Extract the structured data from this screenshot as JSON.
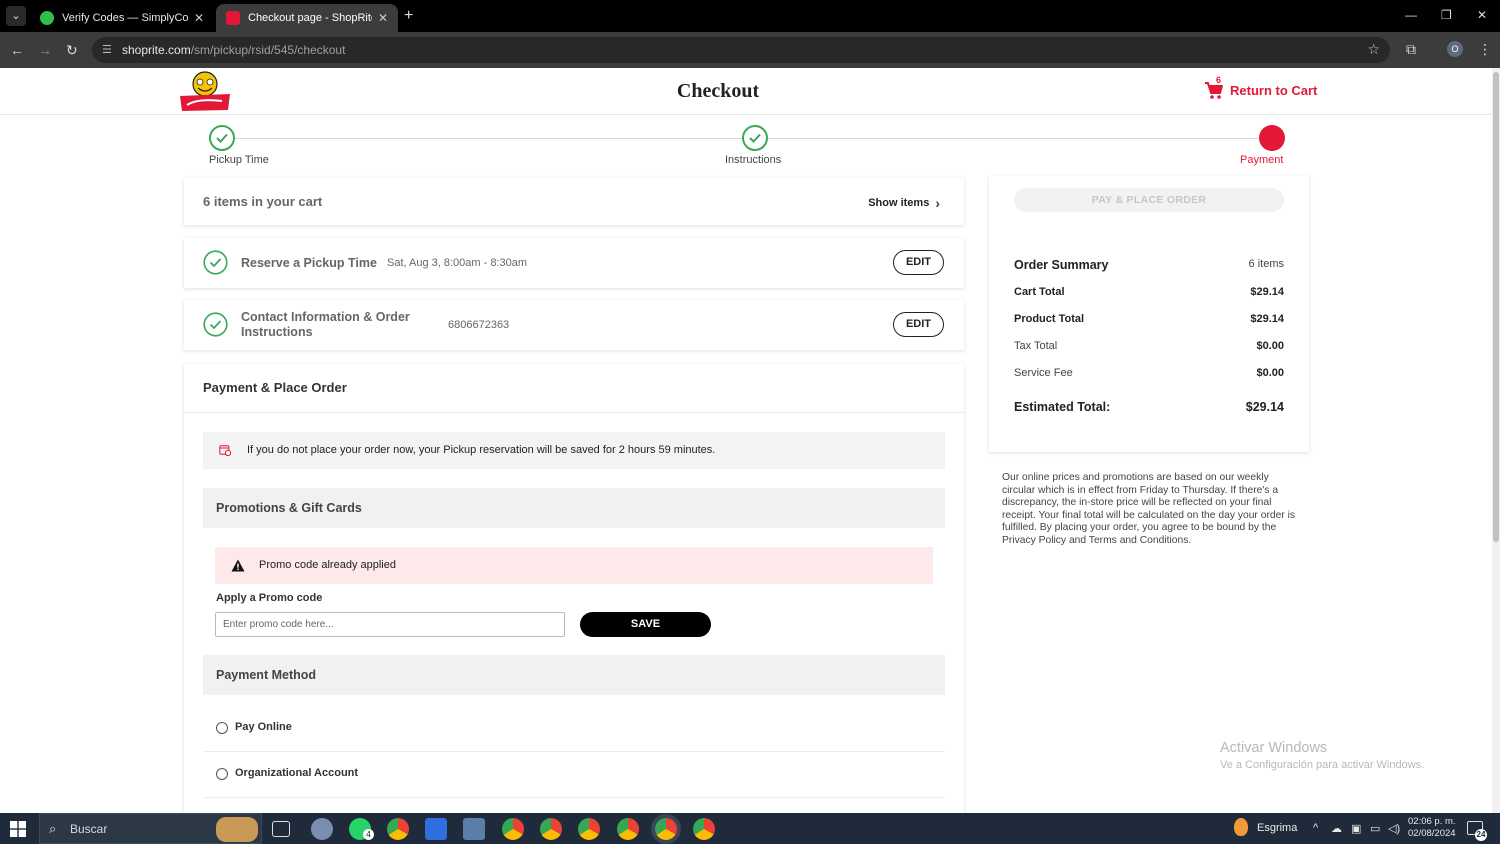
{
  "browser": {
    "tabs": [
      {
        "title": "Verify Codes — SimplyCodes",
        "active": false
      },
      {
        "title": "Checkout page - ShopRite",
        "active": true
      }
    ],
    "url_domain": "shoprite.com",
    "url_path": "/sm/pickup/rsid/545/checkout",
    "profile_initial": "O"
  },
  "header": {
    "title": "Checkout",
    "return_cart_label": "Return to Cart",
    "cart_badge": "6"
  },
  "stepper": {
    "steps": [
      {
        "label": "Pickup Time",
        "state": "done"
      },
      {
        "label": "Instructions",
        "state": "done"
      },
      {
        "label": "Payment",
        "state": "current"
      }
    ]
  },
  "cart": {
    "count_text": "6 items in your cart",
    "show_items_label": "Show items"
  },
  "pickup": {
    "title": "Reserve a Pickup Time",
    "value": "Sat, Aug 3, 8:00am - 8:30am",
    "edit_label": "EDIT"
  },
  "contact": {
    "title_line1": "Contact Information & Order",
    "title_line2": "Instructions",
    "value": "6806672363",
    "edit_label": "EDIT"
  },
  "payment": {
    "heading": "Payment & Place Order",
    "notice": "If you do not place your order now, your Pickup reservation will be saved for 2 hours 59 minutes.",
    "promotions_heading": "Promotions & Gift Cards",
    "promo_alert": "Promo code already applied",
    "promo_label": "Apply a Promo code",
    "promo_placeholder": "Enter promo code here...",
    "save_label": "SAVE",
    "method_heading": "Payment Method",
    "methods": [
      "Pay Online",
      "Organizational Account"
    ]
  },
  "summary": {
    "place_order_label": "PAY & PLACE ORDER",
    "heading": "Order Summary",
    "items_count": "6 items",
    "rows": [
      {
        "label": "Cart Total",
        "value": "$29.14",
        "bold": true
      },
      {
        "label": "Product Total",
        "value": "$29.14",
        "bold": true
      },
      {
        "label": "Tax Total",
        "value": "$0.00",
        "bold": false
      },
      {
        "label": "Service Fee",
        "value": "$0.00",
        "bold": false
      }
    ],
    "total_label": "Estimated Total:",
    "total_value": "$29.14",
    "disclaimer": "Our online prices and promotions are based on our weekly circular which is in effect from Friday to Thursday. If there's a discrepancy, the in-store price will be reflected on your final receipt. Your final total will be calculated on the day your order is fulfilled. By placing your order, you agree to be bound by the Privacy Policy and Terms and Conditions."
  },
  "watermark": {
    "line1": "Activar Windows",
    "line2": "Ve a Configuración para activar Windows."
  },
  "taskbar": {
    "search_label": "Buscar",
    "whatsapp_badge": "4",
    "weather_label": "Esgrima",
    "time": "02:06 p. m.",
    "date": "02/08/2024",
    "notification_count": "24"
  },
  "colors": {
    "brand_red": "#e31837",
    "success_green": "#3aa857"
  }
}
